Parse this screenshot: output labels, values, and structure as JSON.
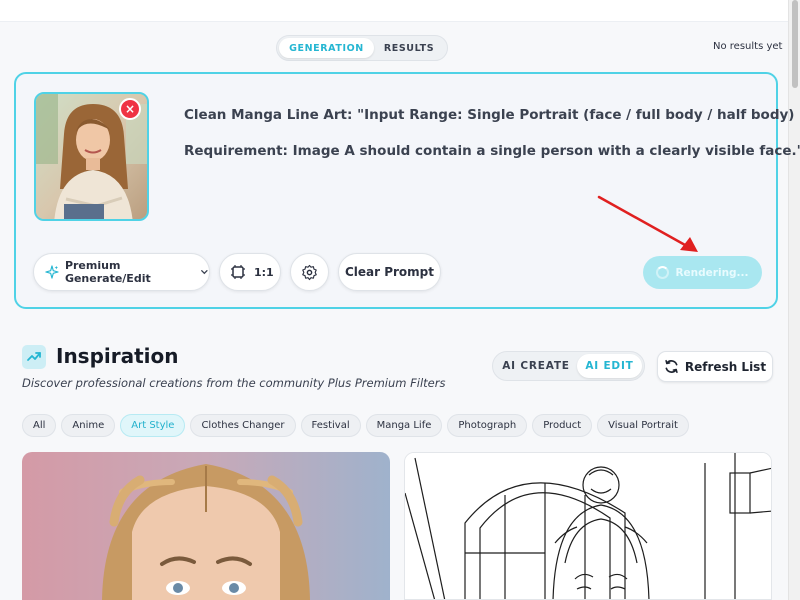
{
  "header": {
    "tabs": [
      {
        "label": "GENERATION",
        "active": true
      },
      {
        "label": "RESULTS",
        "active": false
      }
    ],
    "status_text": "No results yet"
  },
  "generation": {
    "prompt_line1": "Clean Manga Line Art: \"Input Range: Single Portrait (face / full body / half body)",
    "prompt_line2": "Requirement: Image A should contain a single person with a clearly visible face.\"",
    "remove_icon": "×",
    "model_button_label": "Premium Generate/Edit",
    "ratio_label": "1:1",
    "clear_prompt_label": "Clear Prompt",
    "render_button_label": "Rendering...",
    "icons": [
      "sparkle-icon",
      "chevron-down-icon",
      "aspect-ratio-icon",
      "gear-icon",
      "spinner-icon"
    ]
  },
  "inspiration": {
    "title": "Inspiration",
    "subtitle": "Discover professional creations from the community Plus Premium Filters",
    "mode_tabs": [
      {
        "label": "AI CREATE",
        "active": false
      },
      {
        "label": "AI EDIT",
        "active": true
      }
    ],
    "refresh_label": "Refresh List",
    "chips": [
      {
        "label": "All",
        "active": false
      },
      {
        "label": "Anime",
        "active": false
      },
      {
        "label": "Art Style",
        "active": true
      },
      {
        "label": "Clothes Changer",
        "active": false
      },
      {
        "label": "Festival",
        "active": false
      },
      {
        "label": "Manga Life",
        "active": false
      },
      {
        "label": "Photograph",
        "active": false
      },
      {
        "label": "Product",
        "active": false
      },
      {
        "label": "Visual Portrait",
        "active": false
      }
    ]
  },
  "colors": {
    "accent": "#25b6d2",
    "panel_border": "#4fd2e6",
    "remove": "#ef3344",
    "annotation_arrow": "#e02020"
  }
}
